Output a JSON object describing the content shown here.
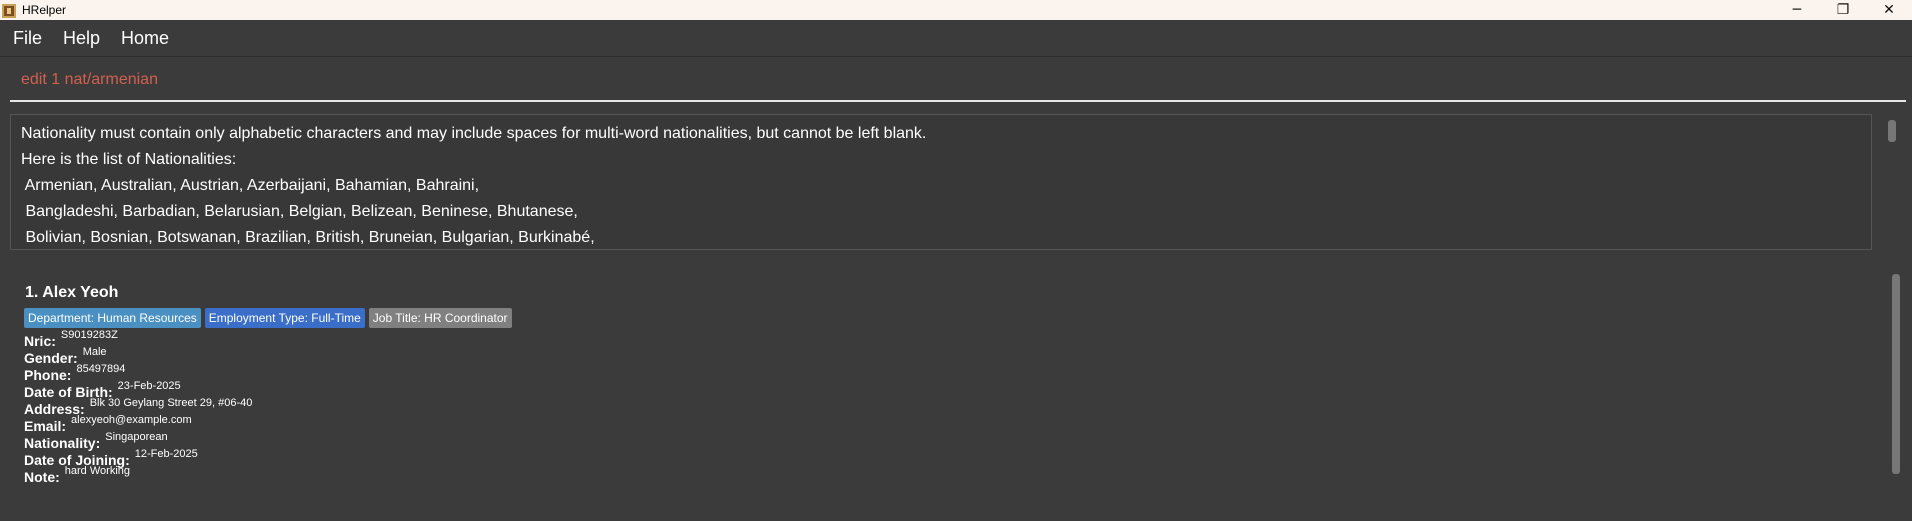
{
  "window": {
    "title": "HRelper",
    "controls": {
      "minimize": "─",
      "restore": "❐",
      "close": "✕"
    }
  },
  "menu": {
    "file": "File",
    "help": "Help",
    "home": "Home"
  },
  "command_box": {
    "value": "edit 1 nat/armenian"
  },
  "result": {
    "lines": [
      "Nationality must contain only alphabetic characters and may include spaces for multi-word nationalities, but cannot be left blank.",
      "Here is the list of Nationalities:",
      " Armenian, Australian, Austrian, Azerbaijani, Bahamian, Bahraini,",
      " Bangladeshi, Barbadian, Belarusian, Belgian, Belizean, Beninese, Bhutanese,",
      " Bolivian, Bosnian, Botswanan, Brazilian, British, Bruneian, Bulgarian, Burkinabé,"
    ]
  },
  "person": {
    "name": "1.  Alex Yeoh",
    "tags": {
      "department": "Department: Human Resources",
      "employment": "Employment Type: Full-Time",
      "job": "Job Title: HR Coordinator"
    },
    "fields": {
      "nric": {
        "label": "Nric:",
        "value": "S9019283Z"
      },
      "gender": {
        "label": "Gender:",
        "value": "Male"
      },
      "phone": {
        "label": "Phone:",
        "value": "85497894"
      },
      "dob": {
        "label": "Date of Birth:",
        "value": "23-Feb-2025"
      },
      "address": {
        "label": "Address:",
        "value": "Blk 30 Geylang Street 29, #06-40"
      },
      "email": {
        "label": "Email:",
        "value": "alexyeoh@example.com"
      },
      "nationality": {
        "label": "Nationality:",
        "value": "Singaporean"
      },
      "doj": {
        "label": "Date of Joining:",
        "value": "12-Feb-2025"
      },
      "note": {
        "label": "Note:",
        "value": "hard Working"
      }
    }
  },
  "colors": {
    "background": "#3b3b3b",
    "command_text": "#d0604f",
    "tag_department": "#4a90c2",
    "tag_employment": "#3a6ec8",
    "tag_job": "#808080"
  }
}
